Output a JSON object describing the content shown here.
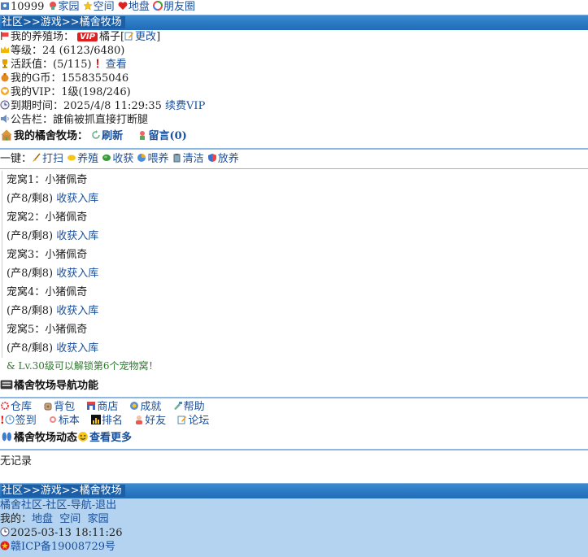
{
  "topnav": {
    "id_text": "10999",
    "home": "家园",
    "space": "空间",
    "land": "地盘",
    "friends": "朋友圈"
  },
  "breadcrumb": "社区>>游戏>>橘舍牧场",
  "profile": {
    "farm_label": "我的养殖场：",
    "vip_badge": "VIP",
    "farm_name": "橘子",
    "edit_open": "[",
    "edit_label": "更改",
    "edit_close": "]",
    "level": "等级：24 (6123/6480)",
    "activity": "活跃值：(5/115)",
    "activity_mark": "！",
    "activity_check": "查看",
    "gcoin": "我的G币：1558355046",
    "vip_level": "我的VIP：1级(198/246)",
    "expire": "到期时间：2025/4/8 11:29:35",
    "renew_vip": "续费VIP",
    "notice": "公告栏：誰偷被抓直接打断腿"
  },
  "farm_section": {
    "title": "我的橘舍牧场：",
    "refresh": "刷新",
    "message": "留言(0)"
  },
  "one_key": {
    "label": "一键：",
    "actions": [
      "打扫",
      "养殖",
      "收获",
      "喂养",
      "清洁",
      "放养"
    ]
  },
  "dens": [
    {
      "name": "宠窝1：小猪佩奇",
      "status": "(产8/剩8)",
      "action": "收获入库"
    },
    {
      "name": "宠窝2：小猪佩奇",
      "status": "(产8/剩8)",
      "action": "收获入库"
    },
    {
      "name": "宠窝3：小猪佩奇",
      "status": "(产8/剩8)",
      "action": "收获入库"
    },
    {
      "name": "宠窝4：小猪佩奇",
      "status": "(产8/剩8)",
      "action": "收获入库"
    },
    {
      "name": "宠窝5：小猪佩奇",
      "status": "(产8/剩8)",
      "action": "收获入库"
    }
  ],
  "unlock_hint": "& Lv.30级可以解锁第6个宠物窝！",
  "nav_section": {
    "title": "橘舍牧场导航功能",
    "row1": [
      "仓库",
      "背包",
      "商店",
      "成就",
      "帮助"
    ],
    "row2_mark": "!",
    "row2": [
      "签到",
      "标本",
      "排名",
      "好友",
      "论坛"
    ]
  },
  "dynamics": {
    "title": "橘舍牧场动态",
    "more": "查看更多",
    "empty": "无记录"
  },
  "footer": {
    "breadcrumb": "社区>>游戏>>橘舍牧场",
    "links_line": "橘舍社区-社区-导航-退出",
    "mine_label": "我的：",
    "mine_links": [
      "地盘",
      "空间",
      "家园"
    ],
    "time": "2025-03-13 18:11:26",
    "icp": "赣ICP备19008729号"
  }
}
